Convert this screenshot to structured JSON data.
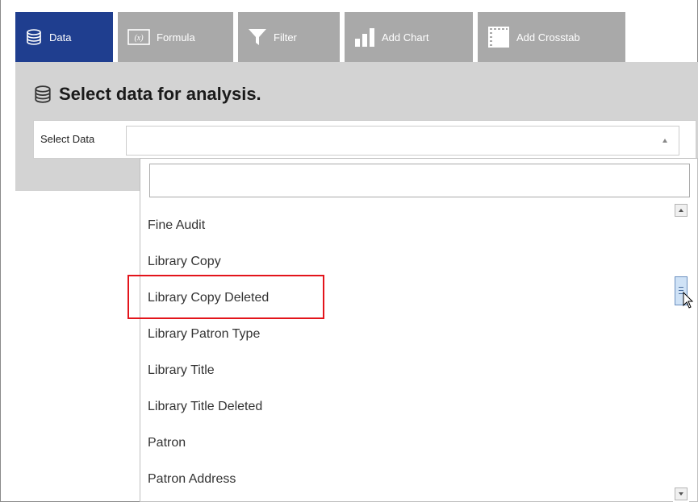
{
  "tabs": [
    {
      "label": "Data",
      "icon": "database-icon",
      "active": true
    },
    {
      "label": "Formula",
      "icon": "formula-icon",
      "active": false
    },
    {
      "label": "Filter",
      "icon": "filter-icon",
      "active": false
    },
    {
      "label": "Add Chart",
      "icon": "bar-chart-icon",
      "active": false
    },
    {
      "label": "Add Crosstab",
      "icon": "crosstab-icon",
      "active": false
    }
  ],
  "panel": {
    "title": "Select data for analysis.",
    "select_label": "Select Data",
    "select_value": ""
  },
  "dropdown": {
    "search_value": "",
    "items": [
      "Fine Audit",
      "Library Copy",
      "Library Copy Deleted",
      "Library Patron Type",
      "Library Title",
      "Library Title Deleted",
      "Patron",
      "Patron Address"
    ],
    "highlighted_item": "Library Copy Deleted"
  },
  "colors": {
    "active_tab": "#1f3e8f",
    "inactive_tab": "#a9a9a9",
    "panel_bg": "#d3d3d3",
    "highlight_border": "#e3141b"
  }
}
